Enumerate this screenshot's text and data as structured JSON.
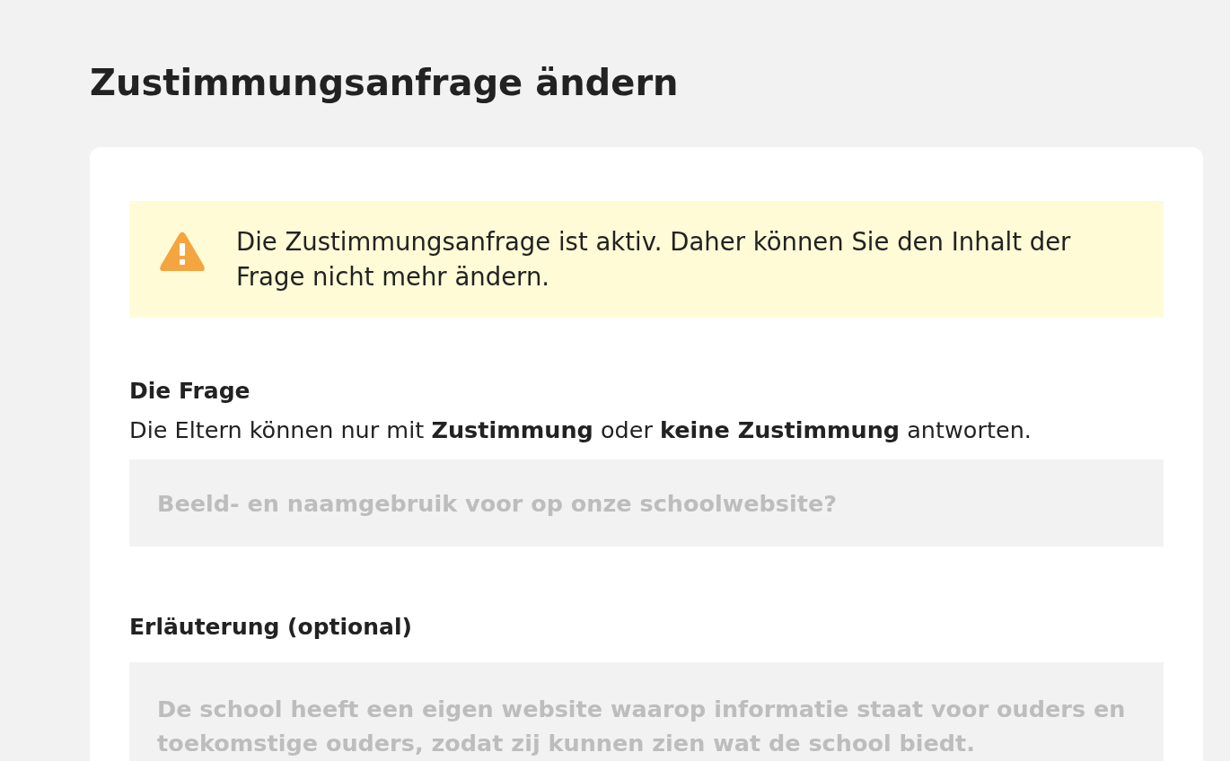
{
  "page": {
    "title": "Zustimmungsanfrage ändern"
  },
  "alert": {
    "kind": "warning",
    "text": "Die Zustimmungsanfrage ist aktiv. Daher können Sie den Inhalt der Frage nicht mehr ändern."
  },
  "fields": [
    {
      "kind": "input",
      "label": "Die Frage",
      "hint": "Die Eltern können nur mit **Zustimmung** oder **keine Zustimmung** antworten.",
      "value": "Beeld- en naamgebruik voor op onze schoolwebsite?",
      "disabled": true
    },
    {
      "kind": "textarea",
      "label": "Erläuterung (optional)",
      "value": "De school heeft een eigen website waarop informatie staat voor ouders en toekomstige ouders, zodat zij kunnen zien wat de school biedt.",
      "disabled": true
    }
  ]
}
